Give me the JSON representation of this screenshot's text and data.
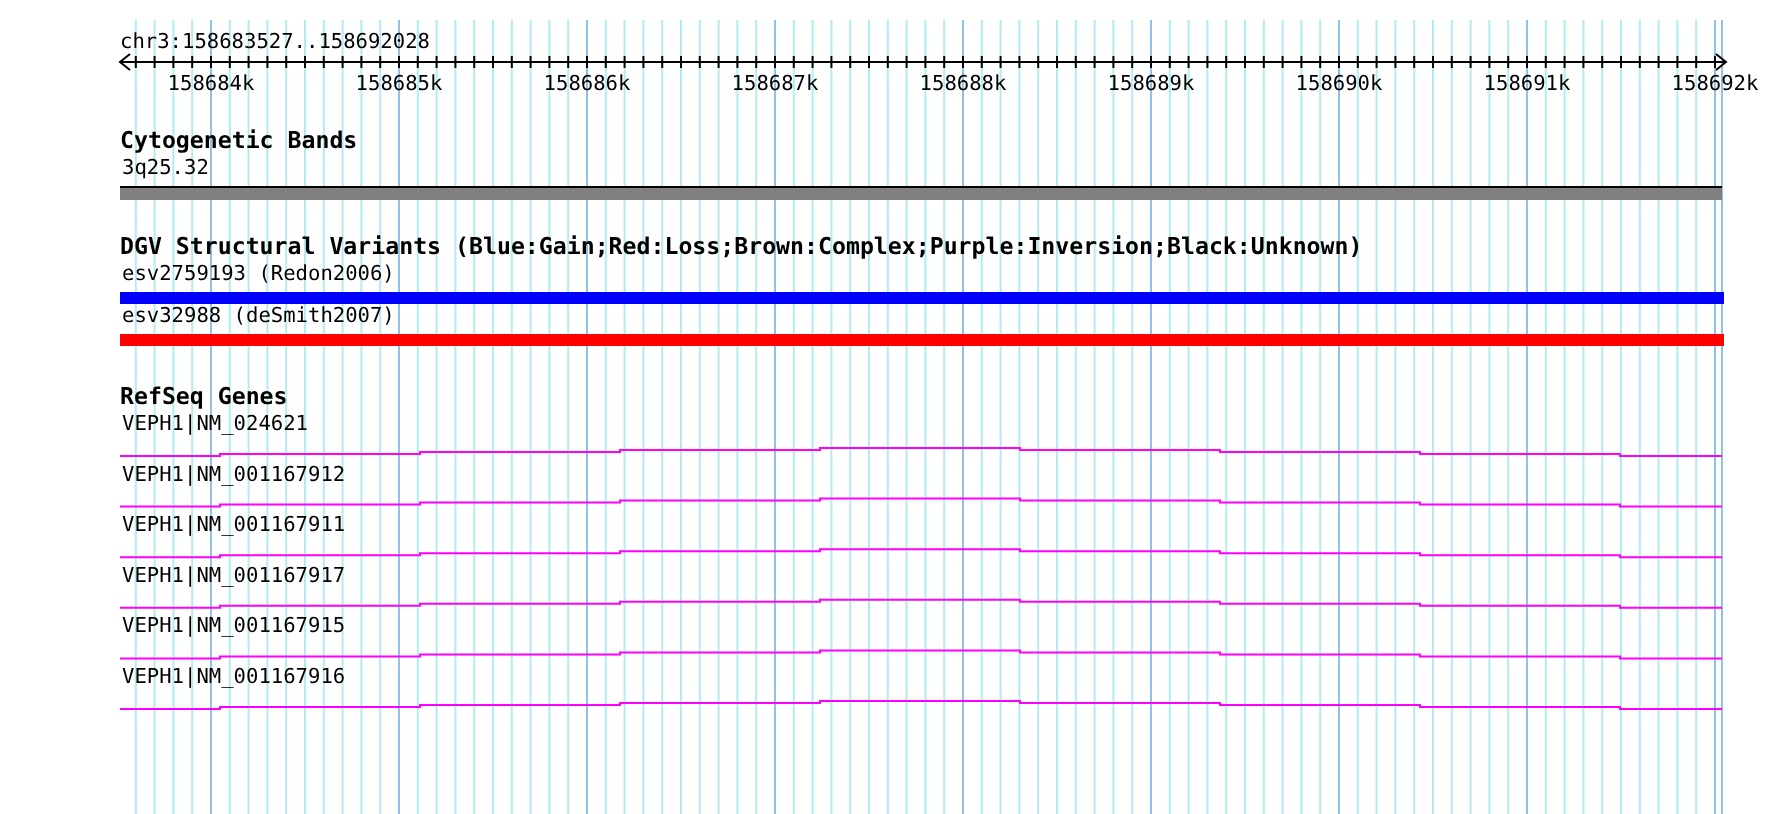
{
  "ruler": {
    "range": "chr3:158683527..158692028",
    "ticks": [
      "158684k",
      "158685k",
      "158686k",
      "158687k",
      "158688k",
      "158689k",
      "158690k",
      "158691k",
      "158692k"
    ]
  },
  "tracks": [
    {
      "kind": "bands",
      "title": "Cytogenetic Bands",
      "features": [
        {
          "label": "3q25.32"
        }
      ]
    },
    {
      "kind": "variants",
      "title": "DGV Structural Variants (Blue:Gain;Red:Loss;Brown:Complex;Purple:Inversion;Black:Unknown)",
      "features": [
        {
          "label": "esv2759193 (Redon2006)",
          "color": "#0000ff"
        },
        {
          "label": "esv32988 (deSmith2007)",
          "color": "#ff0000"
        }
      ]
    },
    {
      "kind": "genes",
      "title": "RefSeq Genes",
      "features": [
        {
          "label": "VEPH1|NM_024621"
        },
        {
          "label": "VEPH1|NM_001167912"
        },
        {
          "label": "VEPH1|NM_001167911"
        },
        {
          "label": "VEPH1|NM_001167917"
        },
        {
          "label": "VEPH1|NM_001167915"
        },
        {
          "label": "VEPH1|NM_001167916"
        }
      ]
    }
  ]
}
